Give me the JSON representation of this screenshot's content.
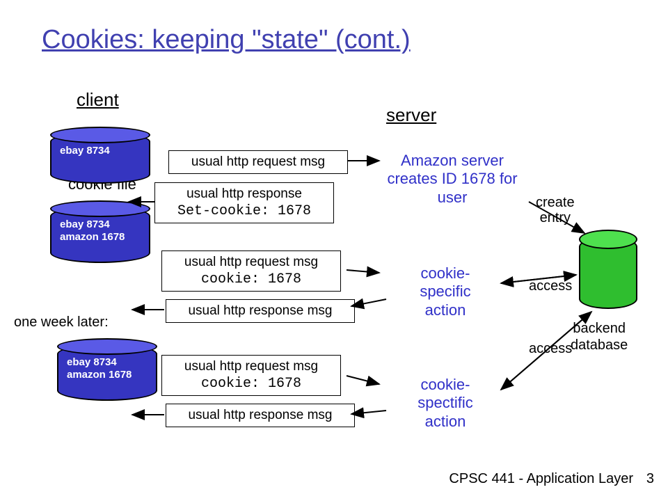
{
  "title": "Cookies: keeping \"state\" (cont.)",
  "labels": {
    "client": "client",
    "server": "server",
    "cookie_file": "cookie file",
    "one_week": "one week later:",
    "backend_db": "backend\ndatabase",
    "create_entry": "create\nentry",
    "access1": "access",
    "access2": "access"
  },
  "cylinders": {
    "c1": "ebay 8734",
    "c2": "ebay 8734\namazon 1678",
    "c3": "ebay 8734\namazon 1678"
  },
  "messages": {
    "m1": "usual http request msg",
    "m2_line1": "usual http response",
    "m2_line2": "Set-cookie: 1678",
    "m3_line1": "usual http request msg",
    "m3_line2": "cookie: 1678",
    "m4": "usual http response msg",
    "m5_line1": "usual http request msg",
    "m5_line2": "cookie: 1678",
    "m6": "usual http response msg"
  },
  "notes": {
    "n1": "Amazon server creates ID 1678 for user",
    "n2": "cookie-\nspecific\naction",
    "n3": "cookie-\nspectific\naction"
  },
  "footer": {
    "course": "CPSC 441 - Application Layer",
    "page": "3"
  }
}
